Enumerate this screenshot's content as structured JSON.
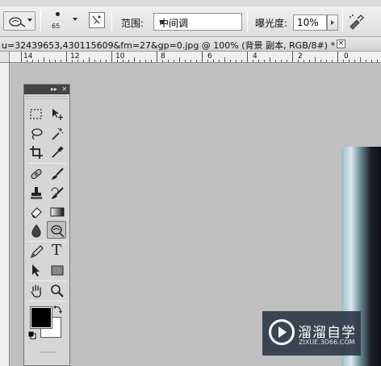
{
  "options_bar": {
    "brush_size": "65",
    "range_label": "范围:",
    "range_value": "中间调",
    "exposure_label": "曝光度:",
    "exposure_value": "10%"
  },
  "document": {
    "tab_title": "u=32439653,430115609&fm=27&gp=0.jpg @ 100% (背景 副本, RGB/8#) *",
    "close_glyph": "×"
  },
  "ruler": {
    "labels": [
      "14",
      "12",
      "10",
      "8",
      "6",
      "4",
      "2",
      "0"
    ]
  },
  "toolbox": {
    "collapse_glyph": "▸▸",
    "close_glyph": "×",
    "tools": [
      {
        "name": "rectangular-marquee-tool",
        "icon": "marquee-icon"
      },
      {
        "name": "move-tool",
        "icon": "move-icon"
      },
      {
        "name": "lasso-tool",
        "icon": "lasso-icon"
      },
      {
        "name": "magic-wand-tool",
        "icon": "magic-wand-icon"
      },
      {
        "name": "crop-tool",
        "icon": "crop-icon"
      },
      {
        "name": "eyedropper-tool",
        "icon": "eyedropper-icon"
      },
      {
        "name": "healing-brush-tool",
        "icon": "bandage-icon"
      },
      {
        "name": "brush-tool",
        "icon": "brush-icon"
      },
      {
        "name": "clone-stamp-tool",
        "icon": "stamp-icon"
      },
      {
        "name": "history-brush-tool",
        "icon": "history-brush-icon"
      },
      {
        "name": "eraser-tool",
        "icon": "eraser-icon"
      },
      {
        "name": "gradient-tool",
        "icon": "gradient-icon"
      },
      {
        "name": "blur-tool",
        "icon": "blur-drop-icon"
      },
      {
        "name": "dodge-tool",
        "icon": "dodge-icon"
      },
      {
        "name": "pen-tool",
        "icon": "pen-icon"
      },
      {
        "name": "type-tool",
        "icon": "type-icon"
      },
      {
        "name": "path-selection-tool",
        "icon": "arrow-icon"
      },
      {
        "name": "shape-tool",
        "icon": "rectangle-shape-icon"
      },
      {
        "name": "hand-tool",
        "icon": "hand-icon"
      },
      {
        "name": "zoom-tool",
        "icon": "zoom-icon"
      }
    ],
    "active_tool": "dodge-tool",
    "type_glyph": "T",
    "foreground_color": "#000000",
    "background_color": "#ffffff"
  },
  "watermark": {
    "title": "溜溜自学",
    "subtitle": "ZIXUE.3D66.COM"
  },
  "colors": {
    "panel_header": "#444444",
    "canvas_bg": "#c0c0c0",
    "watermark_bg": "#283242"
  }
}
